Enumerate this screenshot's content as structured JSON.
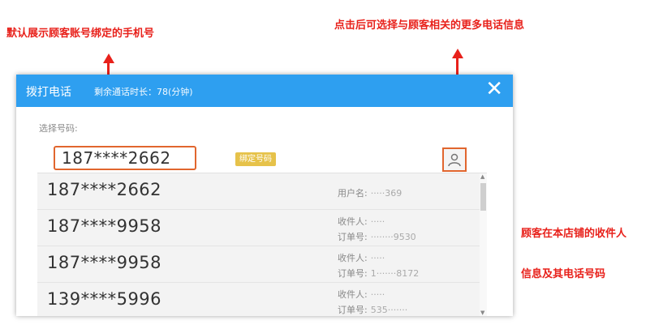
{
  "annotations": {
    "top_left": "默认展示顾客账号绑定的手机号",
    "top_right": "点击后可选择与顾客相关的更多电话信息",
    "right_line1": "顾客在本店铺的收件人",
    "right_line2": "信息及其电话号码"
  },
  "dialog": {
    "title": "拨打电话",
    "subtitle": "剩余通话时长：78(分钟)",
    "close_glyph": "✕",
    "select_label": "选择号码:",
    "selected_phone": "187****2662",
    "bound_badge": "绑定号码"
  },
  "contacts": [
    {
      "phone": "187****2662",
      "line1": "用户名:",
      "line1_value": "·····369",
      "line2": "",
      "line2_value": ""
    },
    {
      "phone": "187****9958",
      "line1": "收件人:",
      "line1_value": "·····",
      "line2": "订单号:",
      "line2_value": "········9530"
    },
    {
      "phone": "187****9958",
      "line1": "收件人:",
      "line1_value": "·····",
      "line2": "订单号:",
      "line2_value": "1·······8172"
    },
    {
      "phone": "139****5996",
      "line1": "收件人:",
      "line1_value": "·····",
      "line2": "订单号:",
      "line2_value": "535·······"
    }
  ],
  "colors": {
    "annotation_red": "#e8211b",
    "titlebar_blue": "#2e9ff0",
    "highlight_orange": "#e1662e",
    "badge_yellow": "#e6c24a"
  },
  "icons": {
    "avatar": "person-icon",
    "close": "close-icon"
  }
}
